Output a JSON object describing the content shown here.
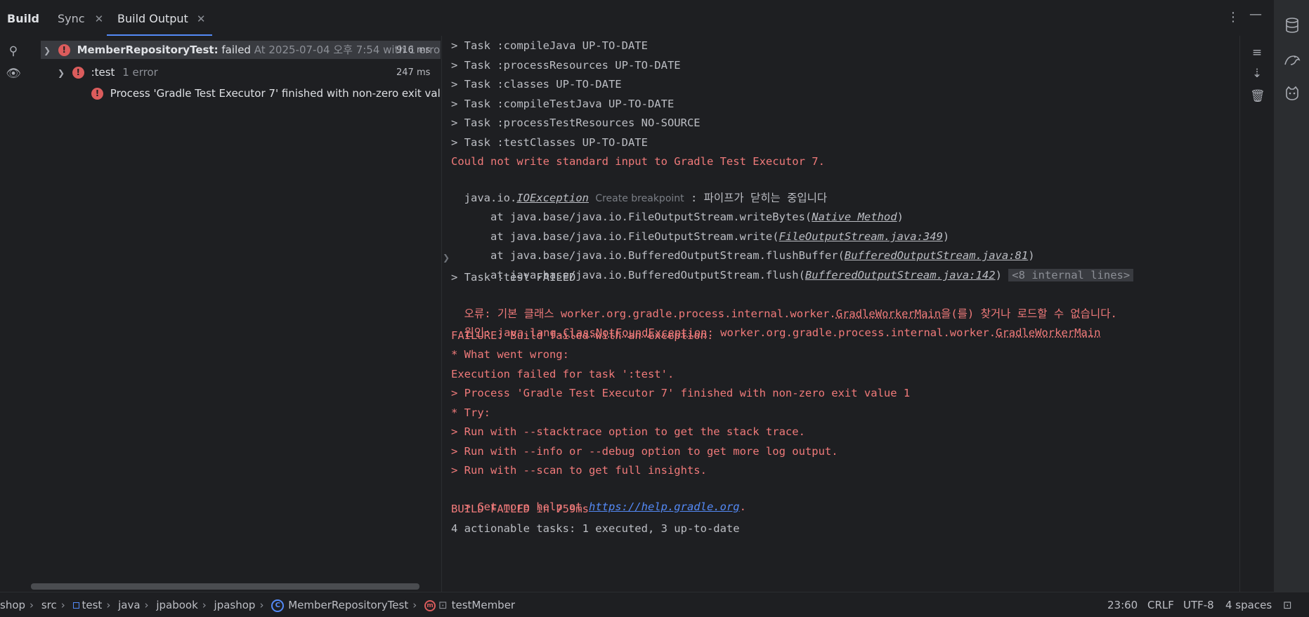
{
  "header": {
    "tabs": [
      {
        "label": "Build"
      },
      {
        "label": "Sync"
      },
      {
        "label": "Build Output"
      }
    ]
  },
  "tree": {
    "root": {
      "name": "MemberRepositoryTest:",
      "status": "failed",
      "detail": "At 2025-07-04 오후 7:54 with 1 erro",
      "duration": "916 ms"
    },
    "child": {
      "name": ":test",
      "detail": "1 error",
      "duration": "247 ms"
    },
    "leaf": {
      "message": "Process 'Gradle Test Executor 7' finished with non-zero exit value 1"
    }
  },
  "console": {
    "l1": "> Task :compileJava UP-TO-DATE",
    "l2": "> Task :processResources UP-TO-DATE",
    "l3": "> Task :classes UP-TO-DATE",
    "l4": "> Task :compileTestJava UP-TO-DATE",
    "l5": "> Task :processTestResources NO-SOURCE",
    "l6": "> Task :testClasses UP-TO-DATE",
    "l7": "Could not write standard input to Gradle Test Executor 7.",
    "l8_prefix": "java.io.",
    "l8_link": "IOException",
    "l8_hint": "Create breakpoint",
    "l8_suffix": " : 파이프가 닫히는 중입니다",
    "l9_prefix": "    at java.base/java.io.FileOutputStream.writeBytes(",
    "l9_link": "Native Method",
    "l10_prefix": "    at java.base/java.io.FileOutputStream.write(",
    "l10_link": "FileOutputStream.java:349",
    "l11_prefix": "    at java.base/java.io.BufferedOutputStream.flushBuffer(",
    "l11_link": "BufferedOutputStream.java:81",
    "l12_prefix": "    at java.base/java.io.BufferedOutputStream.flush(",
    "l12_link": "BufferedOutputStream.java:142",
    "l12_fold": "<8 internal lines>",
    "l13": "> Task :test FAILED",
    "l14_prefix": "오류: 기본 클래스 worker.org.gradle.process.internal.worker.",
    "l14_dotted": "GradleWorkerMain",
    "l14_suffix": "을(를) 찾거나 로드할 수 없습니다.",
    "l15_prefix": "원인: java.lang.",
    "l15_dotted": "ClassNotFoundException",
    "l15_mid": ": worker.org.gradle.process.internal.worker.",
    "l15_dotted2": "GradleWorkerMain",
    "l16": "FAILURE: Build failed with an exception.",
    "l17": "* What went wrong:",
    "l18": "Execution failed for task ':test'.",
    "l19": "> Process 'Gradle Test Executor 7' finished with non-zero exit value 1",
    "l20": "* Try:",
    "l21": "> Run with --stacktrace option to get the stack trace.",
    "l22": "> Run with --info or --debug option to get more log output.",
    "l23": "> Run with --scan to get full insights.",
    "l24_prefix": "> Get more help at ",
    "l24_link": "https://help.gradle.org",
    "l24_suffix": ".",
    "l25": "BUILD FAILED in 759ms",
    "l26": "4 actionable tasks: 1 executed, 3 up-to-date"
  },
  "status": {
    "crumbs": [
      "shop",
      "src",
      "test",
      "java",
      "jpabook",
      "jpashop",
      "MemberRepositoryTest",
      "testMember"
    ],
    "position": "23:60",
    "line_sep": "CRLF",
    "encoding": "UTF-8",
    "indent": "4 spaces"
  },
  "colors": {
    "accent": "#548af7",
    "error": "#f07a7a",
    "error_icon": "#db5c5c",
    "background": "#1e1f22"
  }
}
